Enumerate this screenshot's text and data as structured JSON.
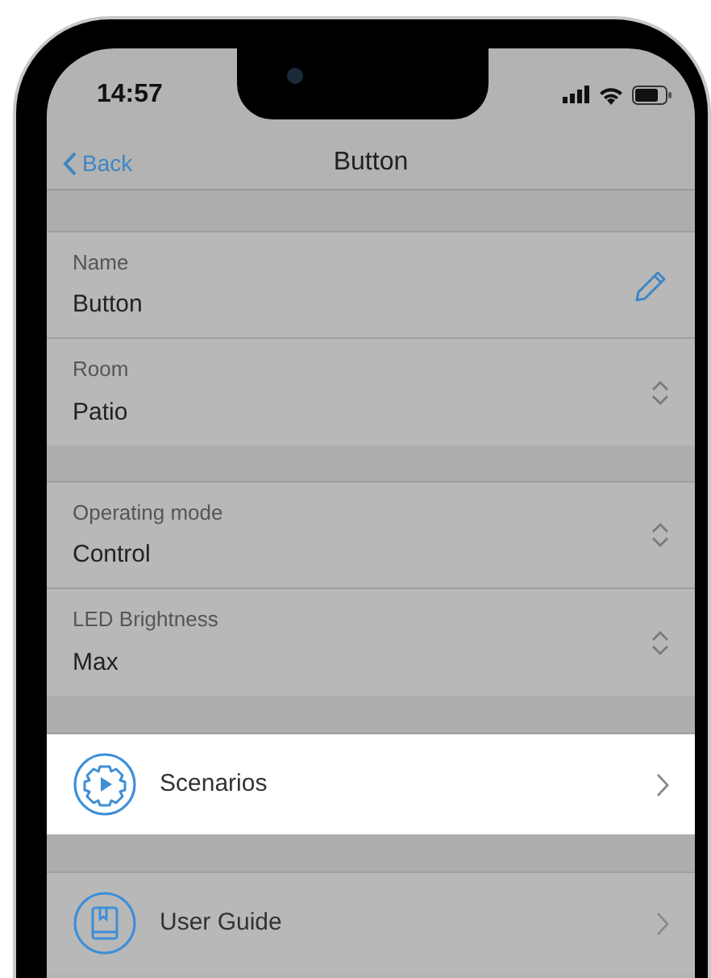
{
  "status_bar": {
    "time": "14:57"
  },
  "nav": {
    "back": "Back",
    "title": "Button"
  },
  "sections": [
    {
      "rows": [
        {
          "kind": "editable",
          "label": "Name",
          "value": "Button"
        },
        {
          "kind": "select",
          "label": "Room",
          "value": "Patio"
        }
      ]
    },
    {
      "rows": [
        {
          "kind": "select",
          "label": "Operating mode",
          "value": "Control"
        },
        {
          "kind": "select",
          "label": "LED Brightness",
          "value": "Max"
        }
      ]
    },
    {
      "rows": [
        {
          "kind": "link",
          "label": "Scenarios",
          "highlighted": true
        }
      ]
    },
    {
      "rows": [
        {
          "kind": "link",
          "label": "User Guide",
          "highlighted": false
        }
      ]
    }
  ]
}
